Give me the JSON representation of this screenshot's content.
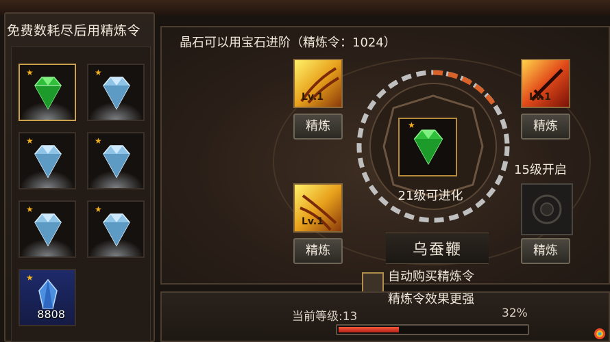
{
  "left_panel": {
    "title": "免费数耗尽后用精炼令",
    "items": [
      {
        "kind": "green-gem",
        "selected": true,
        "count": ""
      },
      {
        "kind": "blue-gem",
        "selected": false,
        "count": ""
      },
      {
        "kind": "blue-gem",
        "selected": false,
        "count": ""
      },
      {
        "kind": "blue-gem",
        "selected": false,
        "count": ""
      },
      {
        "kind": "blue-gem",
        "selected": false,
        "count": ""
      },
      {
        "kind": "blue-gem",
        "selected": false,
        "count": ""
      },
      {
        "kind": "crystal",
        "selected": false,
        "count": "8808"
      }
    ]
  },
  "info": {
    "text": "晶石可以用宝石进阶（精炼令：1024）"
  },
  "skills": {
    "top_left": {
      "level": "Lv.1",
      "button": "精炼"
    },
    "bottom_left": {
      "level": "Lv.1",
      "button": "精炼"
    },
    "top_right": {
      "level": "Lv.1",
      "button": "精炼"
    },
    "bottom_right": {
      "level": "",
      "button": "精炼"
    }
  },
  "center": {
    "caption": "21级可进化",
    "item_name": "乌蚕鞭"
  },
  "unlock_text": "15级开启",
  "options": {
    "auto_buy_label": "自动购买精炼令",
    "effect_label": "精炼令效果更强"
  },
  "progress": {
    "level_label": "当前等级:13",
    "percent_label": "32%",
    "fraction": 0.32
  },
  "colors": {
    "accent_gold": "#c9a24a",
    "progress_red": "#d83a26",
    "ring_orange": "#d9622a"
  }
}
